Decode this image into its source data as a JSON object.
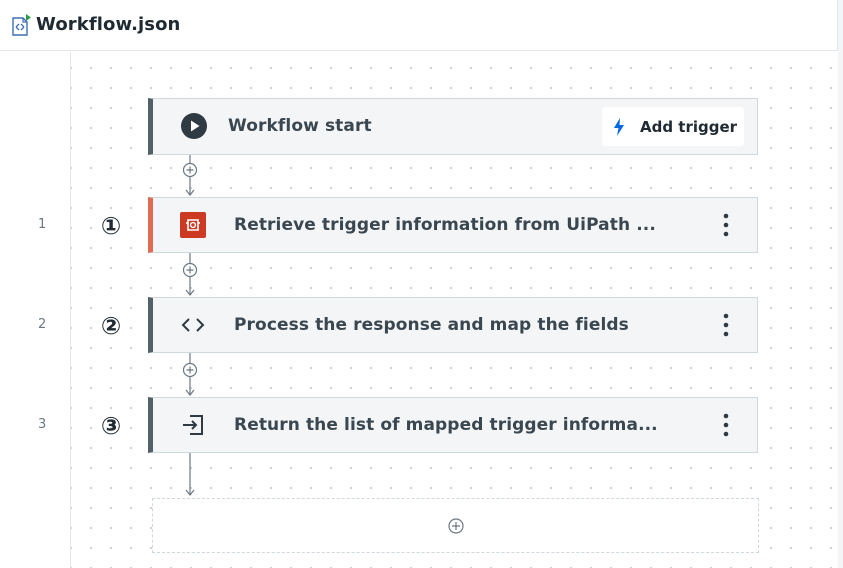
{
  "header": {
    "title": "Workflow.json",
    "icon": "json-file-icon"
  },
  "colors": {
    "node_bg": "#f4f5f7",
    "node_border": "#526069",
    "error_accent": "#e06b55",
    "uipath_red": "#cc3a24",
    "accent_blue": "#0067df"
  },
  "workflow": {
    "start": {
      "label": "Workflow start",
      "add_trigger_label": "Add trigger"
    },
    "steps": [
      {
        "line": "1",
        "marker": "①",
        "label": "Retrieve trigger information from UiPath ...",
        "icon": "uipath-connector-icon"
      },
      {
        "line": "2",
        "marker": "②",
        "label": "Process the response and map the fields",
        "icon": "code-icon"
      },
      {
        "line": "3",
        "marker": "③",
        "label": "Return the list of mapped trigger informa...",
        "icon": "return-icon"
      }
    ]
  }
}
